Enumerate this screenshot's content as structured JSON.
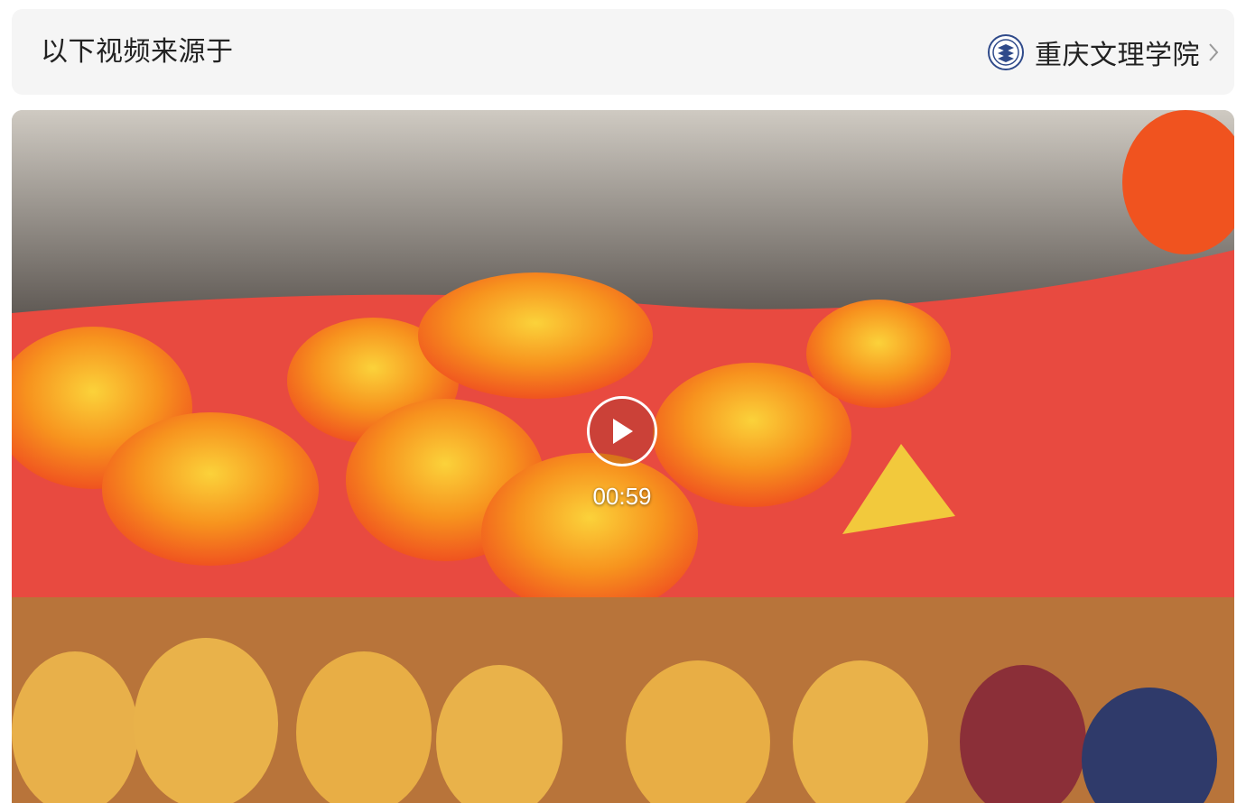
{
  "source_bar": {
    "prefix": "以下视频来源于",
    "source_name": "重庆文理学院",
    "logo_icon": "university-logo-icon",
    "chevron_icon": "chevron-right-icon"
  },
  "video": {
    "duration": "00:59",
    "play_icon": "play-icon",
    "colors": {
      "flag_red": "#e84a40",
      "fan_orange": "#f58a1f",
      "fan_yellow": "#f7d33a",
      "costume_yellow": "#e9b24a"
    }
  }
}
